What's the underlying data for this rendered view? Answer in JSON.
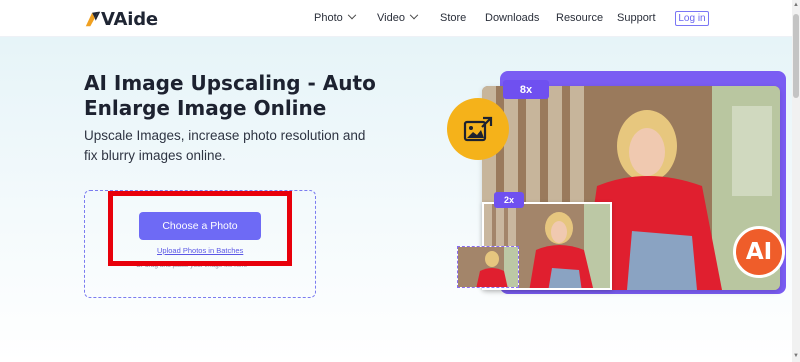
{
  "header": {
    "brand": "VAide",
    "nav": [
      {
        "label": "Photo",
        "dropdown": true
      },
      {
        "label": "Video",
        "dropdown": true
      },
      {
        "label": "Store",
        "dropdown": false
      },
      {
        "label": "Downloads",
        "dropdown": false
      },
      {
        "label": "Resource",
        "dropdown": false
      },
      {
        "label": "Support",
        "dropdown": false
      }
    ],
    "login": "Log in"
  },
  "hero": {
    "title": "AI Image Upscaling - Auto Enlarge Image Online",
    "subtitle": "Upscale Images, increase photo resolution and fix blurry images online.",
    "upload": {
      "choose_button": "Choose a Photo",
      "batch_link": "Upload Photos in Batches",
      "drop_hint": "Or drag and paste your image file here"
    }
  },
  "illustration": {
    "badge_large": "8x",
    "badge_small": "2x",
    "ai_label": "AI",
    "icon": "image-upscale-icon"
  },
  "colors": {
    "accent": "#6e6af5",
    "highlight_frame": "#e8000b",
    "ai_badge": "#ef5d2a",
    "icon_bg": "#f5b21a"
  }
}
